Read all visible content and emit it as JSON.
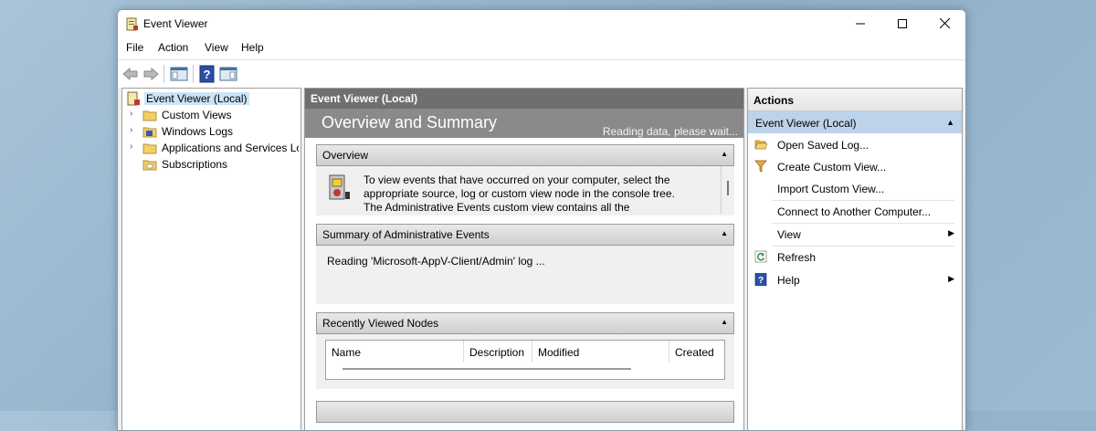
{
  "window": {
    "title": "Event Viewer"
  },
  "menu": [
    "File",
    "Action",
    "View",
    "Help"
  ],
  "tree": {
    "root": "Event Viewer (Local)",
    "items": [
      "Custom Views",
      "Windows Logs",
      "Applications and Services Lo",
      "Subscriptions"
    ]
  },
  "center": {
    "header": "Event Viewer (Local)",
    "overview_title": "Overview and Summary",
    "status": "Reading data, please wait...",
    "overview": {
      "title": "Overview",
      "text": "To view events that have occurred on your computer, select the appropriate source, log or custom view node in the console tree. The Administrative Events custom view contains all the administrative"
    },
    "summary": {
      "title": "Summary of Administrative Events",
      "reading": "Reading 'Microsoft-AppV-Client/Admin' log ..."
    },
    "recent": {
      "title": "Recently Viewed Nodes",
      "columns": [
        "Name",
        "Description",
        "Modified",
        "Created"
      ]
    }
  },
  "actions": {
    "header": "Actions",
    "section": "Event Viewer (Local)",
    "items": [
      {
        "label": "Open Saved Log...",
        "icon": "folder-open-icon"
      },
      {
        "label": "Create Custom View...",
        "icon": "filter-icon"
      },
      {
        "label": "Import Custom View...",
        "icon": ""
      },
      {
        "label": "Connect to Another Computer...",
        "icon": ""
      },
      {
        "label": "View",
        "icon": ""
      },
      {
        "label": "Refresh",
        "icon": "refresh-icon"
      },
      {
        "label": "Help",
        "icon": "help-icon"
      }
    ]
  },
  "colors": {
    "accent": "#bdd3ea",
    "selection": "#cce4f7"
  }
}
